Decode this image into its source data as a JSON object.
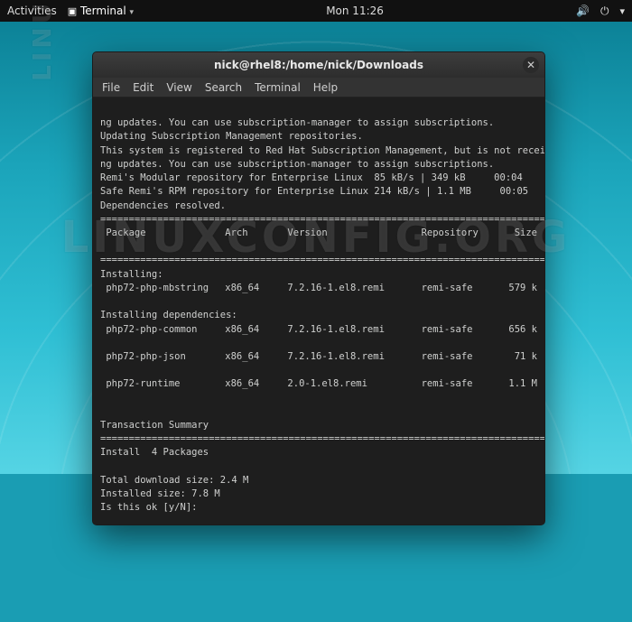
{
  "topbar": {
    "activities": "Activities",
    "app": "Terminal",
    "clock": "Mon 11:26"
  },
  "window": {
    "title": "nick@rhel8:/home/nick/Downloads",
    "menus": [
      "File",
      "Edit",
      "View",
      "Search",
      "Terminal",
      "Help"
    ]
  },
  "term": {
    "pre": [
      "ng updates. You can use subscription-manager to assign subscriptions.",
      "Updating Subscription Management repositories.",
      "This system is registered to Red Hat Subscription Management, but is not receivi",
      "ng updates. You can use subscription-manager to assign subscriptions.",
      "Remi's Modular repository for Enterprise Linux  85 kB/s | 349 kB     00:04",
      "Safe Remi's RPM repository for Enterprise Linux 214 kB/s | 1.1 MB     00:05",
      "Dependencies resolved."
    ],
    "hdr": {
      "c1": " Package",
      "c2": "Arch",
      "c3": "Version",
      "c4": "Repository",
      "c5": "Size"
    },
    "s1": "Installing:",
    "r1": {
      "c1": " php72-php-mbstring",
      "c2": "x86_64",
      "c3": "7.2.16-1.el8.remi",
      "c4": "remi-safe",
      "c5": "579 k"
    },
    "s2": "Installing dependencies:",
    "r2": {
      "c1": " php72-php-common",
      "c2": "x86_64",
      "c3": "7.2.16-1.el8.remi",
      "c4": "remi-safe",
      "c5": "656 k"
    },
    "r3": {
      "c1": " php72-php-json",
      "c2": "x86_64",
      "c3": "7.2.16-1.el8.remi",
      "c4": "remi-safe",
      "c5": "71 k"
    },
    "r4": {
      "c1": " php72-runtime",
      "c2": "x86_64",
      "c3": "2.0-1.el8.remi",
      "c4": "remi-safe",
      "c5": "1.1 M"
    },
    "summary_hdr": "Transaction Summary",
    "install_line": "Install  4 Packages",
    "dl": "Total download size: 2.4 M",
    "inst": "Installed size: 7.8 M",
    "prompt": "Is this ok [y/N]: "
  },
  "watermark": "LINUXCONFIG.ORG"
}
